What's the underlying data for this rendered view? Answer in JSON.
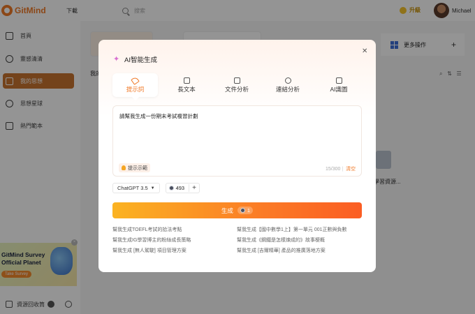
{
  "topbar": {
    "logo_text": "GitMind",
    "download_label": "下載",
    "search_placeholder": "搜索",
    "upgrade_label": "升級",
    "user_name": "Michael"
  },
  "sidebar": {
    "items": [
      {
        "label": "首頁"
      },
      {
        "label": "靈感清清"
      },
      {
        "label": "我的思想"
      },
      {
        "label": "思想星球"
      },
      {
        "label": "熱門範本"
      }
    ],
    "promo": {
      "title": "GitMind Survey Official Planet",
      "button": "Take Survey"
    },
    "bottom_label": "資源回收筒"
  },
  "background": {
    "more_actions_label": "更多操作",
    "section_label": "我的",
    "file_label": "學習資源..."
  },
  "modal": {
    "title": "AI智能生成",
    "tabs": [
      {
        "label": "提示詞"
      },
      {
        "label": "長文本"
      },
      {
        "label": "文件分析"
      },
      {
        "label": "連結分析"
      },
      {
        "label": "AI識圖"
      }
    ],
    "prompt_value": "請幫我生成一份期末考試複習計劃",
    "example_label": "提示示範",
    "char_count": "15/300",
    "clear_label": "清空",
    "model": "ChatGPT 3.5",
    "credits": "493",
    "generate_label": "生成",
    "generate_cost": "1",
    "suggestions": [
      "幫我生成TOEFL考試的拾法考點",
      "幫我生成【國中數學1上】第一單元 001正數與負數",
      "幫我生成IG學習博主的粉絲成長策略",
      "幫我生成《鋼鐵是怎樣煉成的》故事梗概",
      "幫我生成 [無人駕駛] 項目管理方案",
      "幫我生成 [吉爾精華] 產品的推廣落地方案"
    ]
  },
  "colors": {
    "accent": "#f07a28",
    "sidebar_active": "#c8742f"
  }
}
